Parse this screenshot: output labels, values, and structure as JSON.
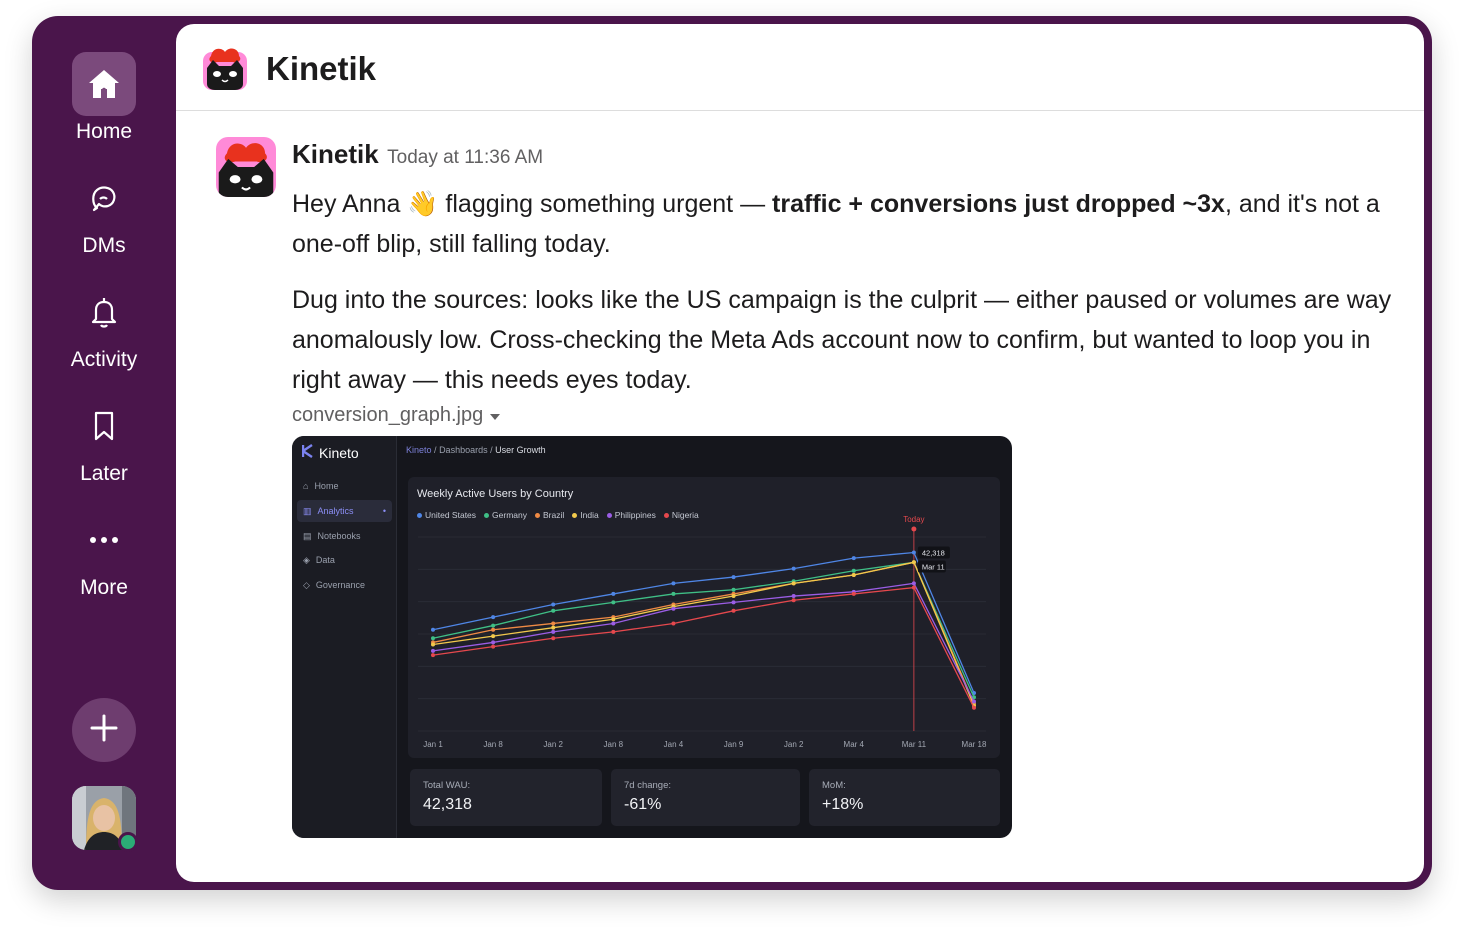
{
  "app": {
    "workspace_title": "Kinetik",
    "colors": {
      "sidebar": "#4a154b",
      "active_item": "#7b4a7c",
      "presence": "#2bac76"
    }
  },
  "rail": {
    "items": [
      {
        "label": "Home",
        "icon": "home-icon",
        "active": true
      },
      {
        "label": "DMs",
        "icon": "dms-icon",
        "active": false
      },
      {
        "label": "Activity",
        "icon": "bell-icon",
        "active": false
      },
      {
        "label": "Later",
        "icon": "bookmark-icon",
        "active": false
      },
      {
        "label": "More",
        "icon": "more-icon",
        "active": false
      }
    ],
    "add_icon": "plus-icon",
    "user_status": "online"
  },
  "message": {
    "author": "Kinetik",
    "time": "Today at 11:36 AM",
    "p1_pre": "Hey Anna 👋 flagging something urgent — ",
    "p1_bold": "traffic + conversions just dropped ~3x",
    "p1_post": ", and it's not a one-off blip, still falling today.",
    "p2": "Dug into the sources: looks like the US campaign is the culprit — either paused or volumes are way anomalously low. Cross-checking the Meta Ads account now to confirm, but wanted to loop you in right away — this needs eyes today.",
    "attachment_name": "conversion_graph.jpg"
  },
  "screenshot": {
    "brand": "Kineto",
    "breadcrumb": [
      "Kineto",
      "Dashboards",
      "User Growth"
    ],
    "nav": [
      {
        "label": "Home",
        "active": false
      },
      {
        "label": "Analytics",
        "active": true
      },
      {
        "label": "Notebooks",
        "active": false
      },
      {
        "label": "Data",
        "active": false
      },
      {
        "label": "Governance",
        "active": false
      }
    ],
    "stats": [
      {
        "label": "Total WAU:",
        "value": "42,318"
      },
      {
        "label": "7d change:",
        "value": "-61%"
      },
      {
        "label": "MoM:",
        "value": "+18%"
      }
    ]
  },
  "chart_data": {
    "type": "line",
    "title": "Weekly Active Users by Country",
    "categories": [
      "Jan 1",
      "Jan 8",
      "Jan 2",
      "Jan 8",
      "Jan 4",
      "Jan 9",
      "Jan 2",
      "Mar 4",
      "Mar 11",
      "Mar 18"
    ],
    "series": [
      {
        "name": "United States",
        "color": "#4f86e6",
        "values": [
          24000,
          27000,
          30000,
          32500,
          35000,
          36500,
          38500,
          41000,
          42318,
          9000
        ]
      },
      {
        "name": "Germany",
        "color": "#3fbf86",
        "values": [
          22000,
          25000,
          28500,
          30500,
          32500,
          33500,
          35500,
          38000,
          40000,
          8000
        ]
      },
      {
        "name": "Brazil",
        "color": "#ef8a44",
        "values": [
          21000,
          24000,
          25500,
          27000,
          30000,
          32500,
          35000,
          37000,
          40000,
          6500
        ]
      },
      {
        "name": "India",
        "color": "#f2c94c",
        "values": [
          20500,
          22500,
          24500,
          26500,
          29500,
          32000,
          35000,
          37000,
          40000,
          6000
        ]
      },
      {
        "name": "Philippines",
        "color": "#9b5de5",
        "values": [
          19000,
          21000,
          23500,
          25500,
          29000,
          30500,
          32000,
          33000,
          35000,
          7000
        ]
      },
      {
        "name": "Nigeria",
        "color": "#e5484d",
        "values": [
          18000,
          20000,
          22000,
          23500,
          25500,
          28500,
          31000,
          32500,
          34000,
          5500
        ]
      }
    ],
    "marker_label": "Today",
    "marker_category": "Mar 11",
    "tooltip": {
      "value": "42,318",
      "date": "Mar 11"
    },
    "ylim": [
      0,
      46000
    ],
    "grid": true,
    "legend": "top-left"
  }
}
